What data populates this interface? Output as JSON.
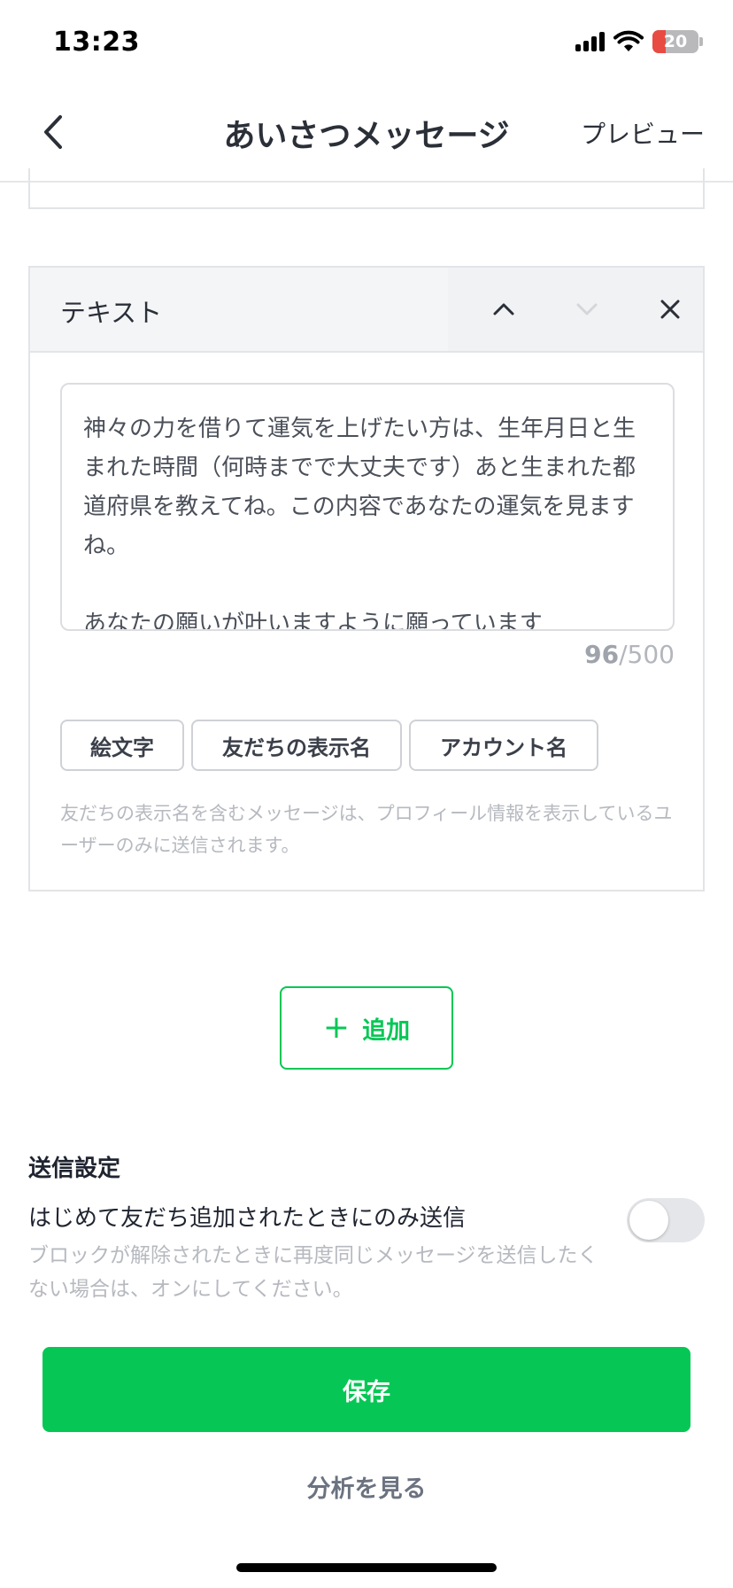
{
  "status_bar": {
    "time": "13:23",
    "battery_level": "20",
    "icons": [
      "signal-icon",
      "wifi-icon",
      "battery-icon"
    ]
  },
  "nav": {
    "back_icon": "chevron-left-icon",
    "title": "あいさつメッセージ",
    "preview_label": "プレビュー"
  },
  "text_block": {
    "title": "テキスト",
    "actions": [
      "chevron-up-icon",
      "chevron-down-icon",
      "close-icon"
    ],
    "message": "神々の力を借りて運気を上げたい方は、生年月日と生まれた時間（何時までで大丈夫です）あと生まれた都道府県を教えてね。この内容であなたの運気を見ますね。\n\nあなたの願いが叶いますように願っています",
    "char_count": "96",
    "char_limit": "/500",
    "chips": [
      "絵文字",
      "友だちの表示名",
      "アカウント名"
    ],
    "note": "友だちの表示名を含むメッセージは、プロフィール情報を表示しているユーザーのみに送信されます。"
  },
  "add_button": {
    "icon": "plus-icon",
    "label": "追加"
  },
  "send_settings": {
    "title": "送信設定",
    "option_label": "はじめて友だち追加されたときにのみ送信",
    "option_enabled": false,
    "help_text": "ブロックが解除されたときに再度同じメッセージを送信したくない場合は、オンにしてください。"
  },
  "save_label": "保存",
  "analysis_label": "分析を見る",
  "colors": {
    "accent": "#06c755",
    "text": "#1f2430",
    "muted": "#b6b9bf",
    "border": "#e3e4e8"
  }
}
